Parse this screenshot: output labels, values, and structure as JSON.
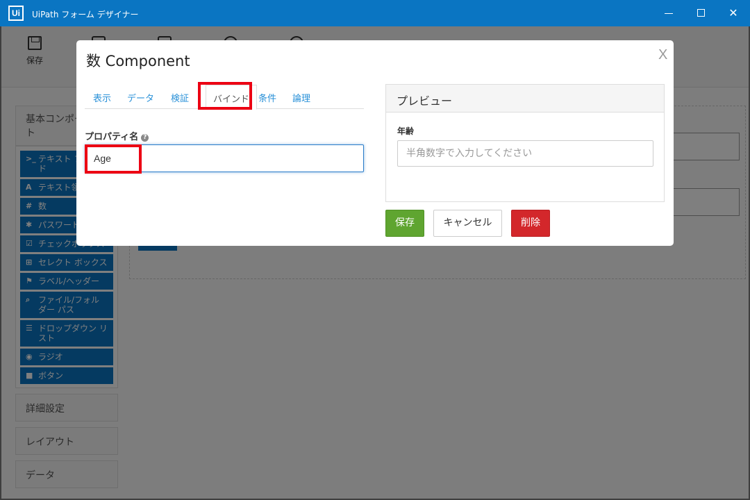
{
  "window": {
    "app_icon": "Ui",
    "title": "UiPath フォーム デザイナー",
    "minimize_icon": "minimize-icon",
    "maximize_icon": "maximize-icon",
    "close_icon": "close-icon"
  },
  "toolbar": {
    "save_label": "保存"
  },
  "sidebar": {
    "header": "基本コンポーネント",
    "items": [
      {
        "icon": ">_",
        "label": "テキスト フィールド"
      },
      {
        "icon": "A",
        "label": "テキスト領域"
      },
      {
        "icon": "#",
        "label": "数"
      },
      {
        "icon": "✱",
        "label": "パスワード"
      },
      {
        "icon": "☑",
        "label": "チェックボックス"
      },
      {
        "icon": "⊞",
        "label": "セレクト ボックス"
      },
      {
        "icon": "⚑",
        "label": "ラベル/ヘッダー"
      },
      {
        "icon": "⌕",
        "label": "ファイル/フォルダー パス"
      },
      {
        "icon": "☰",
        "label": "ドロップダウン リスト"
      },
      {
        "icon": "◉",
        "label": "ラジオ"
      },
      {
        "icon": "■",
        "label": "ボタン"
      }
    ],
    "sections": [
      "詳細設定",
      "レイアウト",
      "データ"
    ]
  },
  "modal": {
    "title": "数 Component",
    "close_label": "X",
    "tabs": [
      "表示",
      "データ",
      "検証",
      "バインド",
      "条件",
      "論理"
    ],
    "active_tab": "バインド",
    "property_label": "プロパティ名",
    "property_value": "Age",
    "preview": {
      "header": "プレビュー",
      "field_label": "年齢",
      "field_placeholder": "半角数字で入力してください"
    },
    "buttons": {
      "save": "保存",
      "cancel": "キャンセル",
      "delete": "削除"
    }
  },
  "colors": {
    "titlebar": "#0a75c2",
    "highlight": "#ec0013",
    "save_button": "#5fa530",
    "delete_button": "#d3272b",
    "tab_link": "#2a91d8"
  }
}
